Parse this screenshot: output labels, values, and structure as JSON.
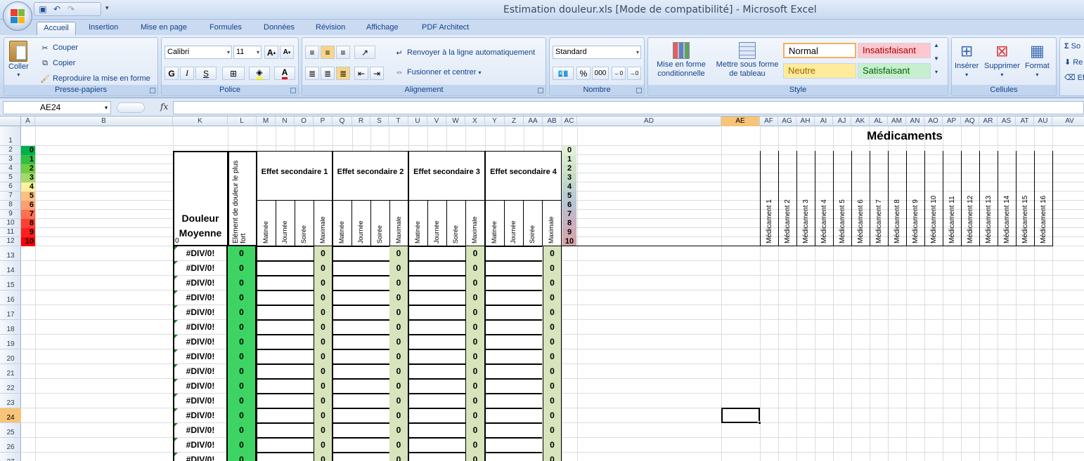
{
  "window": {
    "title": "Estimation douleur.xls  [Mode de compatibilité] - Microsoft Excel"
  },
  "tabs": [
    "Accueil",
    "Insertion",
    "Mise en page",
    "Formules",
    "Données",
    "Révision",
    "Affichage",
    "PDF Architect"
  ],
  "ribbon": {
    "clipboard": {
      "label": "Presse-papiers",
      "paste": "Coller",
      "cut": "Couper",
      "copy": "Copier",
      "format_painter": "Reproduire la mise en forme"
    },
    "font": {
      "label": "Police",
      "name": "Calibri",
      "size": "11",
      "bold": "G",
      "italic": "I",
      "underline": "S"
    },
    "alignment": {
      "label": "Alignement",
      "wrap": "Renvoyer à la ligne automatiquement",
      "merge": "Fusionner et centrer"
    },
    "number": {
      "label": "Nombre",
      "format": "Standard",
      "percent": "%",
      "thousands": "000"
    },
    "style": {
      "label": "Style",
      "conditional": "Mise en forme conditionnelle",
      "as_table": "Mettre sous forme de tableau",
      "normal": "Normal",
      "bad": "Insatisfaisant",
      "neutral": "Neutre",
      "good": "Satisfaisant"
    },
    "cells": {
      "label": "Cellules",
      "insert": "Insérer",
      "delete": "Supprimer",
      "format": "Format"
    },
    "editing": {
      "sum": "So",
      "fill": "Re",
      "clear": "Ef"
    }
  },
  "namebox": "AE24",
  "formula": "",
  "fx": "fx",
  "columns": [
    "A",
    "B",
    "K",
    "L",
    "M",
    "N",
    "O",
    "P",
    "Q",
    "R",
    "S",
    "T",
    "U",
    "V",
    "W",
    "X",
    "Y",
    "Z",
    "AA",
    "AB",
    "AC",
    "AD",
    "AE",
    "AF",
    "AG",
    "AH",
    "AI",
    "AJ",
    "AK",
    "AL",
    "AM",
    "AN",
    "AO",
    "AP",
    "AQ",
    "AR",
    "AS",
    "AT",
    "AU",
    "AV"
  ],
  "rows": [
    "1",
    "2",
    "3",
    "4",
    "5",
    "6",
    "7",
    "8",
    "9",
    "10",
    "11",
    "12",
    "13",
    "14",
    "15",
    "16",
    "17",
    "18",
    "19",
    "20",
    "21",
    "22",
    "23",
    "24",
    "25",
    "26",
    "27"
  ],
  "sheet": {
    "scale_left": [
      "0",
      "1",
      "2",
      "3",
      "4",
      "5",
      "6",
      "7",
      "8",
      "9",
      "10"
    ],
    "scale_right": [
      "0",
      "1",
      "2",
      "3",
      "4",
      "5",
      "6",
      "7",
      "8",
      "9",
      "10"
    ],
    "header_douleur": "Douleur Moyenne",
    "header_element": "Elément de douleur le plus fort",
    "k12": "0",
    "effets": [
      "Effet secondaire 1",
      "Effet secondaire 2",
      "Effet secondaire 3",
      "Effet secondaire 4"
    ],
    "sub": [
      "Matinée",
      "Journée",
      "Soirée",
      "Maximale"
    ],
    "medicaments_title": "Médicaments",
    "medicaments": [
      "Médicament 1",
      "Médicament 2",
      "Médicament 3",
      "Médicament 4",
      "Médicament 5",
      "Médicament 6",
      "Médicament 7",
      "Médicament 8",
      "Médicament 9",
      "Médicament 10",
      "Médicament 11",
      "Médicament 12",
      "Médicament 13",
      "Médicament 14",
      "Médicament 15",
      "Médicament 16"
    ],
    "div_value": "#DIV/0!",
    "zero": "0"
  },
  "colors": {
    "accent": "#15428b",
    "scale_green": "#00b050",
    "col_l": "#3ed464",
    "max_col": "#d7e4bc",
    "selected_header": "#f8c477"
  }
}
